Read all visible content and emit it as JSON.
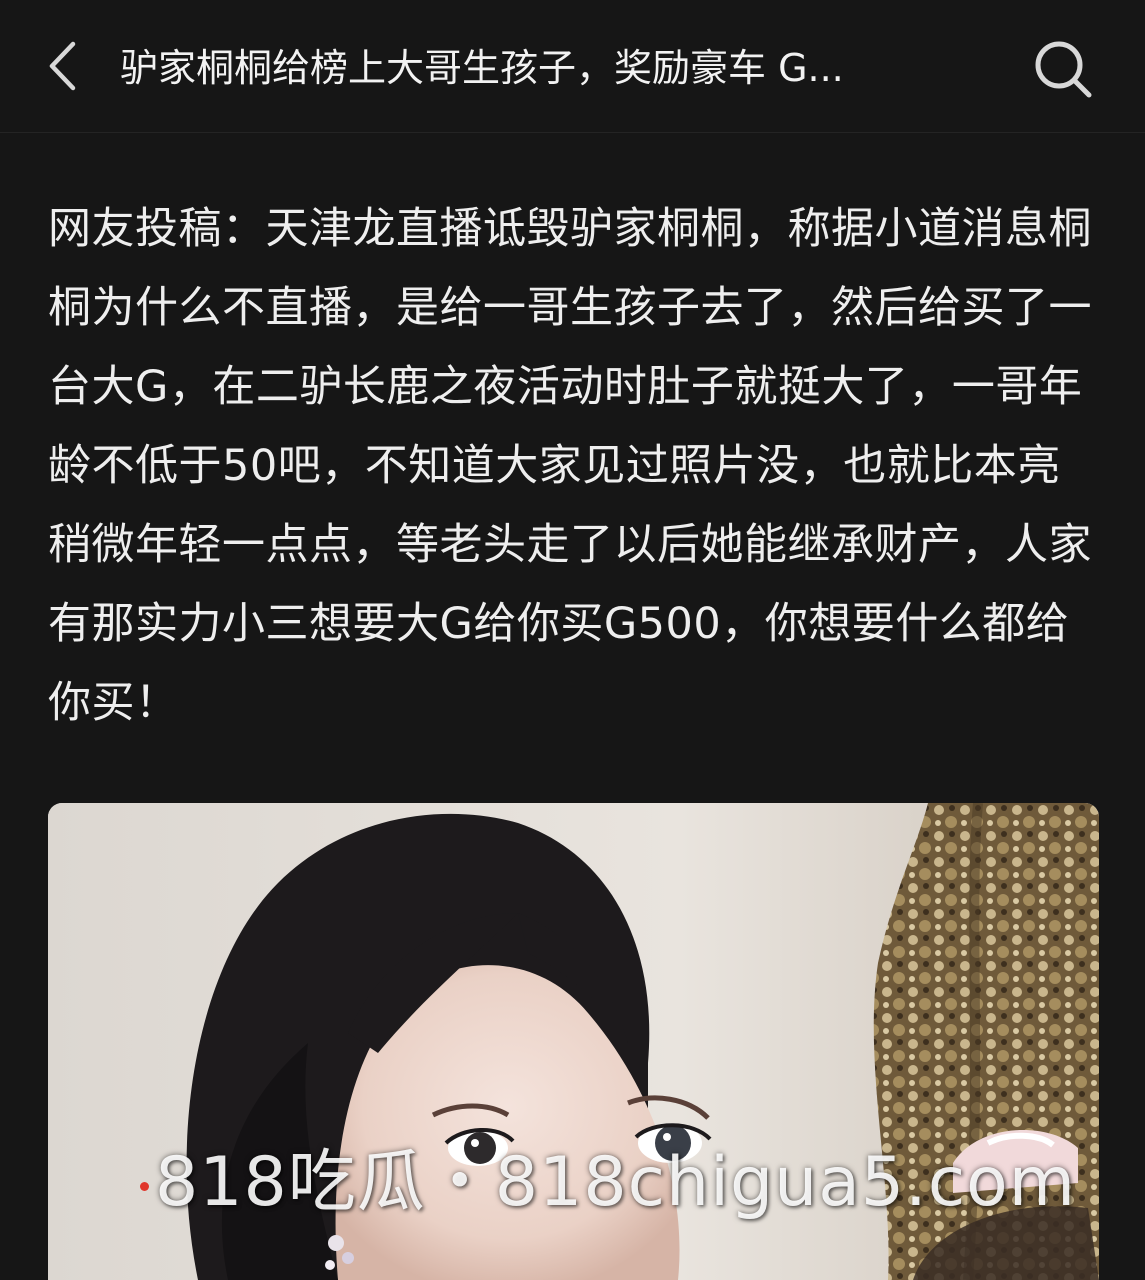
{
  "header": {
    "back_icon": "chevron-left-icon",
    "title": "驴家桐桐给榜上大哥生孩子，奖励豪车 G...",
    "search_icon": "search-icon"
  },
  "article": {
    "body": "网友投稿：天津龙直播诋毁驴家桐桐，称据小道消息桐桐为什么不直播，是给一哥生孩子去了，然后给买了一台大G，在二驴长鹿之夜活动时肚子就挺大了，一哥年龄不低于50吧，不知道大家见过照片没，也就比本亮稍微年轻一点点，等老头走了以后她能继承财产，人家有那实力小三想要大G给你买G500，你想要什么都给你买！"
  },
  "image": {
    "watermark": "818吃瓜・818chigua5.com"
  },
  "colors": {
    "background": "#161616",
    "text": "#eeeeee",
    "watermark_dot": "#e0362b"
  }
}
